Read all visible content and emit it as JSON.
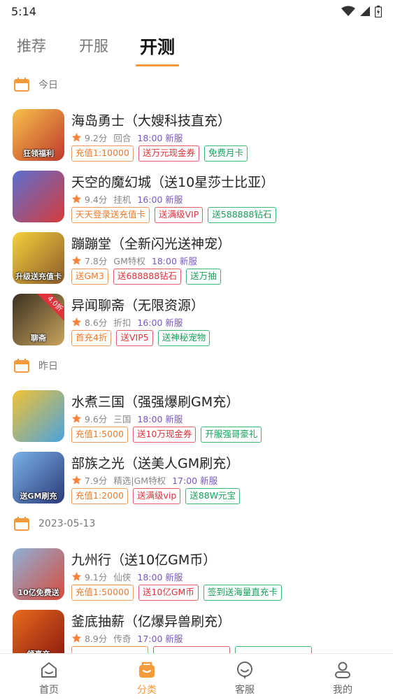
{
  "status_bar": {
    "time": "5:14"
  },
  "tabs": [
    {
      "label": "推荐"
    },
    {
      "label": "开服"
    },
    {
      "label": "开测"
    }
  ],
  "sections": [
    {
      "date": "今日",
      "games": [
        {
          "title": "海岛勇士（大嫂科技直充）",
          "score": "9.2分",
          "category": "回合",
          "time": "18:00 新服",
          "thumb_label": "狂领福利",
          "tags": [
            {
              "text": "充值1:10000",
              "color": "orange"
            },
            {
              "text": "送万元现金券",
              "color": "red"
            },
            {
              "text": "免费月卡",
              "color": "green"
            }
          ]
        },
        {
          "title": "天空的魔幻城（送10星莎士比亚）",
          "score": "9.4分",
          "category": "挂机",
          "time": "16:00 新服",
          "thumb_label": "",
          "tags": [
            {
              "text": "天天登录送充值卡",
              "color": "orange"
            },
            {
              "text": "送满级VIP",
              "color": "red"
            },
            {
              "text": "送588888钻石",
              "color": "green"
            }
          ]
        },
        {
          "title": "蹦蹦堂（全新闪光送神宠）",
          "score": "7.8分",
          "category": "GM特权",
          "time": "18:00 新服",
          "thumb_label": "升级送充值卡",
          "tags": [
            {
              "text": "送GM3",
              "color": "orange"
            },
            {
              "text": "送688888钻石",
              "color": "red"
            },
            {
              "text": "送万抽",
              "color": "green"
            }
          ]
        },
        {
          "title": "异闻聊斋（无限资源）",
          "score": "8.6分",
          "category": "折扣",
          "time": "16:00 新服",
          "thumb_label": "聊斋",
          "thumb_badge": "4.0折",
          "tags": [
            {
              "text": "首充4折",
              "color": "orange"
            },
            {
              "text": "送VIP5",
              "color": "red"
            },
            {
              "text": "送神秘宠物",
              "color": "green"
            }
          ]
        }
      ]
    },
    {
      "date": "昨日",
      "games": [
        {
          "title": "水煮三国（强强爆刷GM充）",
          "score": "9.6分",
          "category": "三国",
          "time": "18:00 新服",
          "thumb_label": "",
          "tags": [
            {
              "text": "充值1:5000",
              "color": "orange"
            },
            {
              "text": "送10万现金券",
              "color": "red"
            },
            {
              "text": "开服强哥豪礼",
              "color": "green"
            }
          ]
        },
        {
          "title": "部族之光（送美人GM刷充）",
          "score": "7.9分",
          "category": "精选|GM特权",
          "time": "17:00 新服",
          "thumb_label": "送GM刷充",
          "tags": [
            {
              "text": "充值1:2000",
              "color": "orange"
            },
            {
              "text": "送满级vip",
              "color": "red"
            },
            {
              "text": "送88W元宝",
              "color": "green"
            }
          ]
        }
      ]
    },
    {
      "date": "2023-05-13",
      "games": [
        {
          "title": "九州行（送10亿GM币）",
          "score": "9.1分",
          "category": "仙侠",
          "time": "18:00 新服",
          "thumb_label": "10亿免费送",
          "tags": [
            {
              "text": "充值1:50000",
              "color": "orange"
            },
            {
              "text": "送10亿GM币",
              "color": "red"
            },
            {
              "text": "签到送海量直充卡",
              "color": "green"
            }
          ]
        },
        {
          "title": "釜底抽薪（亿爆异兽刷充）",
          "score": "8.9分",
          "category": "传奇",
          "time": "17:00 新服",
          "thumb_label": "领真充",
          "tags": [
            {
              "text": "",
              "color": "orange"
            },
            {
              "text": "",
              "color": "red"
            },
            {
              "text": "",
              "color": "green"
            }
          ]
        }
      ]
    }
  ],
  "bottom_nav": [
    {
      "label": "首页",
      "icon": "home-icon"
    },
    {
      "label": "分类",
      "icon": "category-icon"
    },
    {
      "label": "客服",
      "icon": "service-icon"
    },
    {
      "label": "我的",
      "icon": "profile-icon"
    }
  ],
  "colors": {
    "accent": "#f39a3a",
    "time_purple": "#7a56c9",
    "tag_orange": "#f07a2a",
    "tag_red": "#e0333a",
    "tag_green": "#18a05a"
  }
}
